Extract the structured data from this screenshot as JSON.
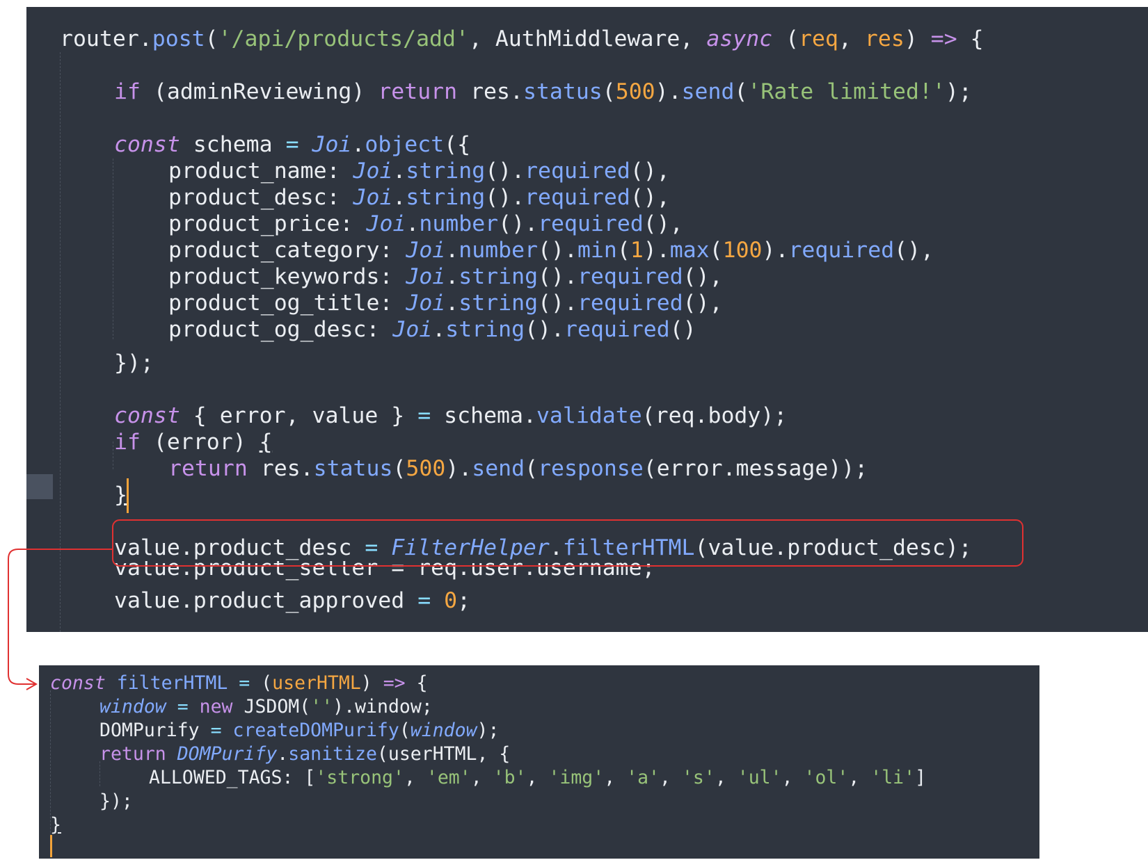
{
  "editor_top": {
    "lines": {
      "l1": {
        "router": "router",
        "post": "post",
        "path": "'/api/products/add'",
        "mw": "AuthMiddleware",
        "async": "async",
        "req": "req",
        "res": "res",
        "arrow": "=>"
      },
      "l2": {
        "if": "if",
        "cond": "adminReviewing",
        "return": "return",
        "res": "res",
        "status": "status",
        "code": "500",
        "send": "send",
        "msg": "'Rate limited!'"
      },
      "l3": {
        "const": "const",
        "name": "schema",
        "joi": "Joi",
        "object": "object"
      },
      "fields": [
        {
          "key": "product_name",
          "type": "string",
          "extra": "",
          "tail": ","
        },
        {
          "key": "product_desc",
          "type": "string",
          "extra": "",
          "tail": ","
        },
        {
          "key": "product_price",
          "type": "number",
          "extra": "",
          "tail": ","
        },
        {
          "key": "product_category",
          "type": "number",
          "extra": "min(1).max(100).",
          "tail": ","
        },
        {
          "key": "product_keywords",
          "type": "string",
          "extra": "",
          "tail": ","
        },
        {
          "key": "product_og_title",
          "type": "string",
          "extra": "",
          "tail": ","
        },
        {
          "key": "product_og_desc",
          "type": "string",
          "extra": "",
          "tail": ""
        }
      ],
      "joi": "Joi",
      "required": "required",
      "close_obj": "});",
      "l13": {
        "const": "const",
        "error": "error",
        "value": "value",
        "schema": "schema",
        "validate": "validate",
        "body": "req.body"
      },
      "l14": {
        "if": "if",
        "cond": "error"
      },
      "l15": {
        "return": "return",
        "res": "res",
        "status": "status",
        "code": "500",
        "send": "send",
        "response": "response",
        "arg": "error.message"
      },
      "l16": {
        "brace": "}"
      },
      "l18": {
        "lhs": "value.product_desc",
        "helper": "FilterHelper",
        "method": "filterHTML",
        "arg": "value.product_desc"
      },
      "l19": {
        "text": "value.product_seller = req.user.username;"
      },
      "l20": {
        "lhs": "value.product_approved",
        "num": "0"
      }
    }
  },
  "editor_bottom": {
    "l1": {
      "const": "const",
      "name": "filterHTML",
      "param": "userHTML",
      "arrow": "=>"
    },
    "l2": {
      "window": "window",
      "new": "new",
      "cls": "JSDOM",
      "prop": "window"
    },
    "l3": {
      "lhs": "DOMPurify",
      "fn": "createDOMPurify",
      "arg": "window"
    },
    "l4": {
      "return": "return",
      "obj": "DOMPurify",
      "method": "sanitize",
      "arg": "userHTML"
    },
    "l5": {
      "key": "ALLOWED_TAGS",
      "tags": [
        "'strong'",
        "'em'",
        "'b'",
        "'img'",
        "'a'",
        "'s'",
        "'ul'",
        "'ol'",
        "'li'"
      ]
    },
    "l6": {
      "text": "});"
    },
    "l7": {
      "text": "}"
    }
  },
  "annotation": {
    "highlight_color": "#e03131"
  }
}
